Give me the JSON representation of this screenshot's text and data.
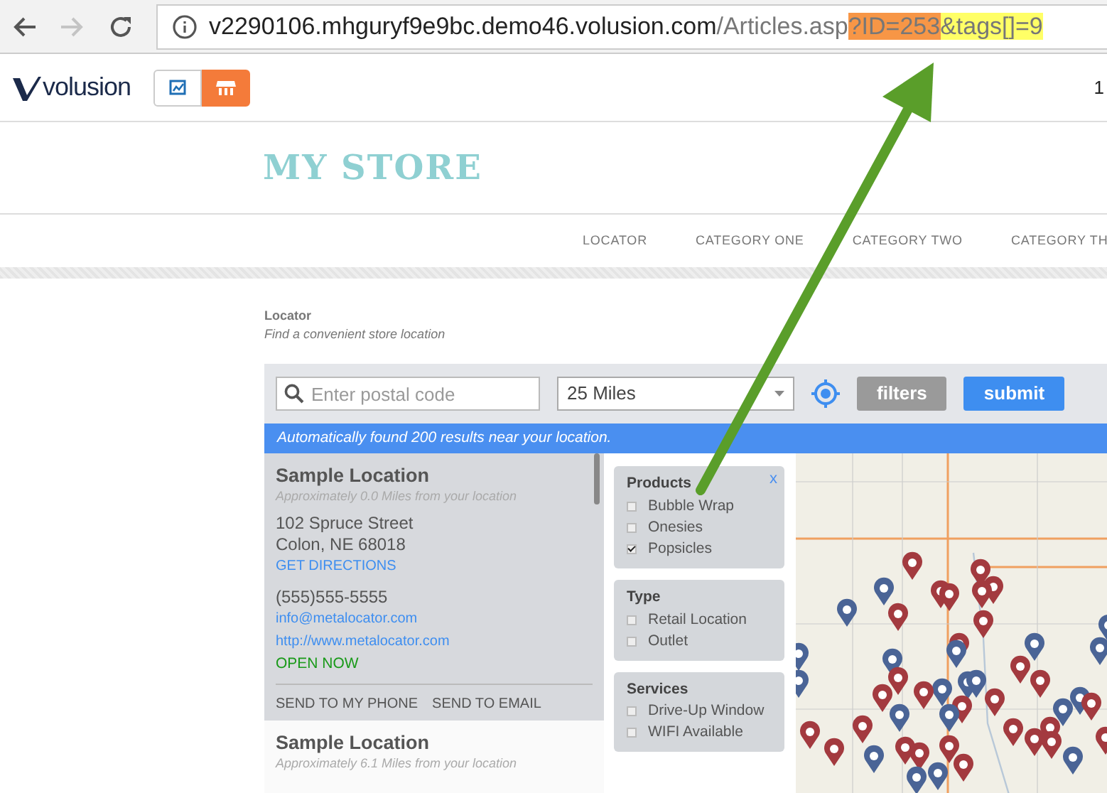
{
  "browser": {
    "url": [
      {
        "text": "v2290106.mhguryf9e9bc.demo46.volusion.com",
        "kind": "host"
      },
      {
        "text": "/Articles.asp",
        "kind": "path"
      },
      {
        "text": "?ID=253",
        "kind": "highlight",
        "color": "#f79646"
      },
      {
        "text": "&tags[]=9",
        "kind": "highlight",
        "color": "#ffff66"
      }
    ],
    "forward_disabled": true
  },
  "admin_bar": {
    "logo": "volusion",
    "buttons": [
      {
        "kind": "chart",
        "selected": false
      },
      {
        "kind": "store",
        "selected": true
      }
    ],
    "corner_text": "1"
  },
  "store": {
    "title": "MY STORE",
    "nav": [
      "LOCATOR",
      "CATEGORY ONE",
      "CATEGORY TWO",
      "CATEGORY TH"
    ]
  },
  "locator": {
    "title": "Locator",
    "subtitle": "Find a convenient store location",
    "search": {
      "placeholder": "Enter postal code"
    },
    "distance": {
      "value": "25 Miles"
    },
    "buttons": [
      {
        "label": "filters",
        "kind": "secondary"
      },
      {
        "label": "submit",
        "kind": "primary"
      }
    ],
    "notice": "Automatically found 200 results near your location.",
    "locations": [
      {
        "name": "Sample Location",
        "distance": "Approximately 0.0 Miles from your location",
        "selected": true,
        "street": "102 Spruce Street",
        "city": "Colon, NE 68018",
        "directions": "GET DIRECTIONS",
        "phone": "(555)555-5555",
        "email": "info@metalocator.com",
        "website": "http://www.metalocator.com",
        "status": "OPEN NOW",
        "actions": [
          "SEND TO MY PHONE",
          "SEND TO EMAIL"
        ]
      },
      {
        "name": "Sample Location",
        "distance": "Approximately 6.1 Miles from your location",
        "selected": false
      }
    ],
    "filters": {
      "close": "x",
      "groups": [
        {
          "title": "Products",
          "options": [
            {
              "label": "Bubble Wrap",
              "checked": false
            },
            {
              "label": "Onesies",
              "checked": false
            },
            {
              "label": "Popsicles",
              "checked": true
            }
          ]
        },
        {
          "title": "Type",
          "options": [
            {
              "label": "Retail Location",
              "checked": false
            },
            {
              "label": "Outlet",
              "checked": false
            }
          ]
        },
        {
          "title": "Services",
          "options": [
            {
              "label": "Drive-Up Window",
              "checked": false
            },
            {
              "label": "WIFI Available",
              "checked": false
            }
          ]
        }
      ]
    }
  }
}
